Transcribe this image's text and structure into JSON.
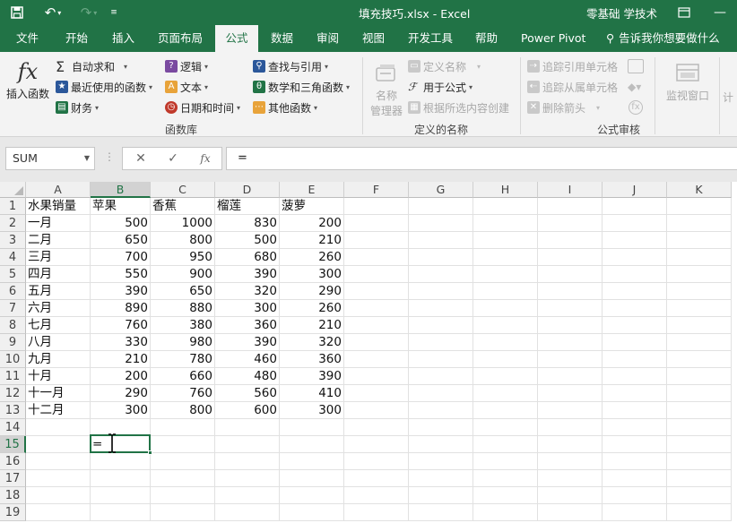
{
  "titlebar": {
    "title": "填充技巧.xlsx  -  Excel",
    "user": "零基础 学技术",
    "qat_icons": [
      "save-icon",
      "undo-icon",
      "redo-icon",
      "customize-qat-icon"
    ]
  },
  "tabs": [
    "文件",
    "开始",
    "插入",
    "页面布局",
    "公式",
    "数据",
    "审阅",
    "视图",
    "开发工具",
    "帮助",
    "Power Pivot"
  ],
  "active_tab": "公式",
  "tell_me": "告诉我你想要做什么",
  "ribbon": {
    "insert_function_label": "插入函数",
    "func_lib": {
      "autosum": "自动求和",
      "recent": "最近使用的函数",
      "finance": "财务",
      "logic": "逻辑",
      "text": "文本",
      "datetime": "日期和时间",
      "lookup": "查找与引用",
      "math": "数学和三角函数",
      "other": "其他函数",
      "group_label": "函数库"
    },
    "defined_names": {
      "name_manager_1": "名称",
      "name_manager_2": "管理器",
      "define_name": "定义名称",
      "use_in_formula": "用于公式",
      "create_from_selection": "根据所选内容创建",
      "group_label": "定义的名称"
    },
    "auditing": {
      "trace_precedents": "追踪引用单元格",
      "trace_dependents": "追踪从属单元格",
      "remove_arrows": "删除箭头",
      "watch_window": "监视窗口",
      "calc_cut": "计",
      "group_label": "公式审核"
    }
  },
  "formula_bar": {
    "name_box": "SUM",
    "cancel": "✕",
    "enter": "✓",
    "fx": "fx",
    "content": "="
  },
  "grid": {
    "columns": [
      "A",
      "B",
      "C",
      "D",
      "E",
      "F",
      "G",
      "H",
      "I",
      "J",
      "K"
    ],
    "selected_column": "B",
    "selected_row": "15",
    "rows": [
      [
        "水果销量",
        "苹果",
        "香蕉",
        "榴莲",
        "菠萝"
      ],
      [
        "一月",
        "500",
        "1000",
        "830",
        "200"
      ],
      [
        "二月",
        "650",
        "800",
        "500",
        "210"
      ],
      [
        "三月",
        "700",
        "950",
        "680",
        "260"
      ],
      [
        "四月",
        "550",
        "900",
        "390",
        "300"
      ],
      [
        "五月",
        "390",
        "650",
        "320",
        "290"
      ],
      [
        "六月",
        "890",
        "880",
        "300",
        "260"
      ],
      [
        "七月",
        "760",
        "380",
        "360",
        "210"
      ],
      [
        "八月",
        "330",
        "980",
        "390",
        "320"
      ],
      [
        "九月",
        "210",
        "780",
        "460",
        "360"
      ],
      [
        "十月",
        "200",
        "660",
        "480",
        "390"
      ],
      [
        "十一月",
        "290",
        "760",
        "560",
        "410"
      ],
      [
        "十二月",
        "300",
        "800",
        "600",
        "300"
      ],
      [
        "",
        "",
        "",
        "",
        ""
      ],
      [
        "",
        "=",
        "",
        "",
        ""
      ],
      [
        "",
        "",
        "",
        "",
        ""
      ],
      [
        "",
        "",
        "",
        "",
        ""
      ],
      [
        "",
        "",
        "",
        "",
        ""
      ],
      [
        "",
        "",
        "",
        "",
        ""
      ]
    ]
  },
  "colors": {
    "accent": "#217346",
    "ribbon_bg": "#f3f3f3",
    "header_bg": "#f0f0f0",
    "gridline": "#e1e1e1"
  }
}
